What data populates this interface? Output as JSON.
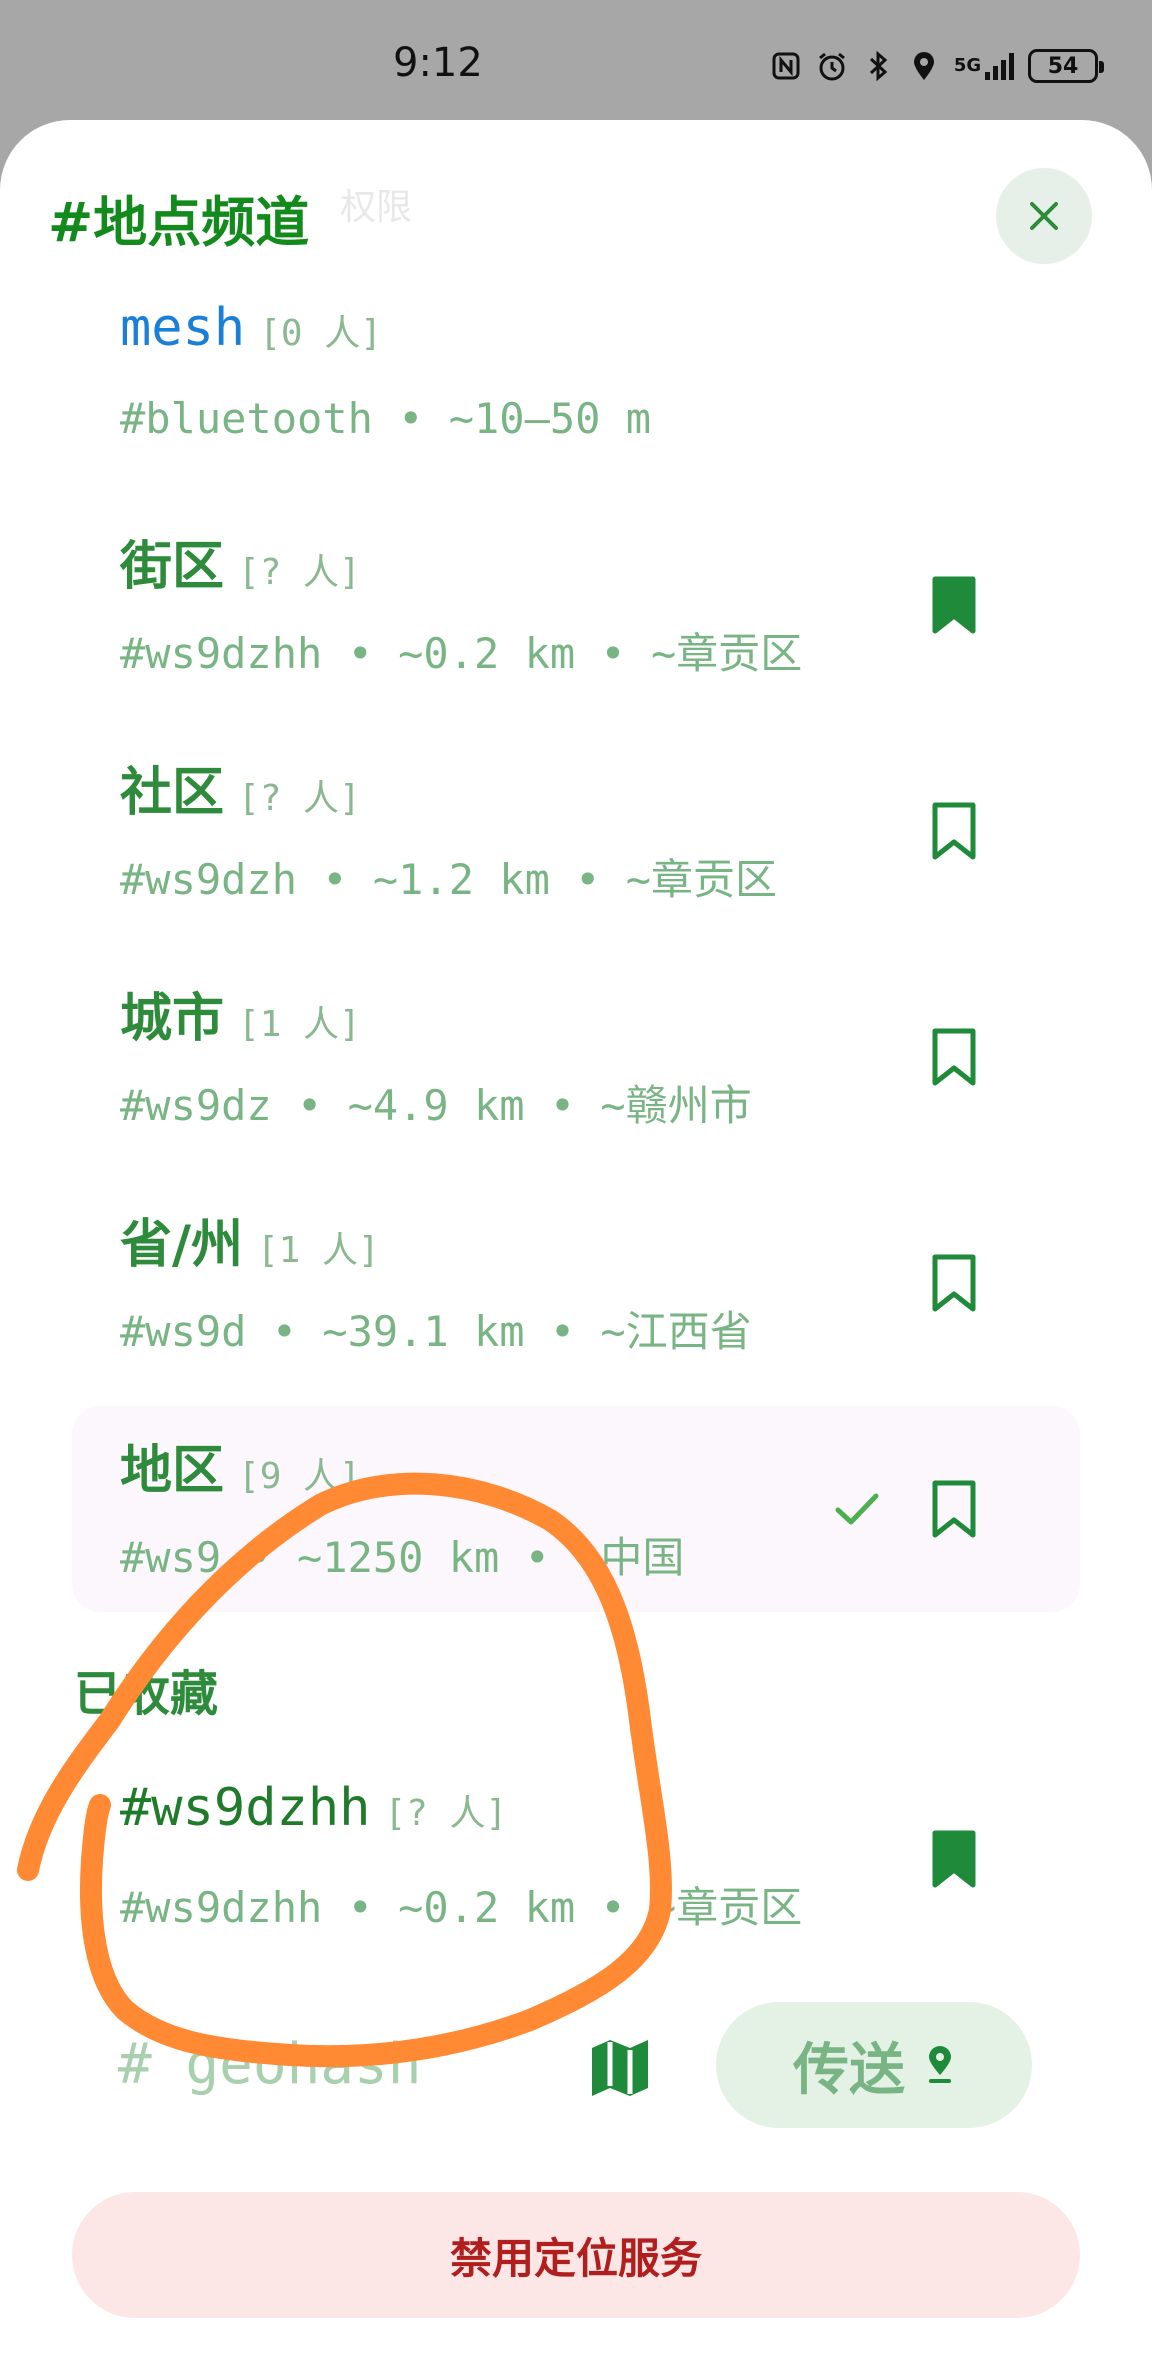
{
  "status_bar": {
    "time": "9:12",
    "network": "5G",
    "battery": "54"
  },
  "sheet": {
    "title": "#地点频道",
    "ghost_title": "权限"
  },
  "channels": [
    {
      "name": "mesh",
      "count": "[0 人]",
      "subtitle": "#bluetooth • ~10–50 m",
      "style": "mesh",
      "bookmark": "none",
      "selected": false
    },
    {
      "name": "街区",
      "count": "[? 人]",
      "subtitle": "#ws9dzhh • ~0.2 km • ~章贡区",
      "style": "normal",
      "bookmark": "filled",
      "selected": false
    },
    {
      "name": "社区",
      "count": "[? 人]",
      "subtitle": "#ws9dzh • ~1.2 km • ~章贡区",
      "style": "normal",
      "bookmark": "outline",
      "selected": false
    },
    {
      "name": "城市",
      "count": "[1 人]",
      "subtitle": "#ws9dz • ~4.9 km • ~赣州市",
      "style": "normal",
      "bookmark": "outline",
      "selected": false
    },
    {
      "name": "省/州",
      "count": "[1 人]",
      "subtitle": "#ws9d • ~39.1 km • ~江西省",
      "style": "normal",
      "bookmark": "outline",
      "selected": false
    },
    {
      "name": "地区",
      "count": "[9 人]",
      "subtitle": "#ws9 • ~1250 km • ~中国",
      "style": "normal",
      "bookmark": "outline",
      "selected": true
    }
  ],
  "bookmarked_section": {
    "label": "已收藏",
    "items": [
      {
        "name": "#ws9dzhh",
        "count": "[? 人]",
        "subtitle": "#ws9dzhh • ~0.2 km • ~章贡区",
        "style": "hash",
        "bookmark": "filled"
      }
    ]
  },
  "geohash_input": {
    "placeholder": "# geohash"
  },
  "send_button": {
    "label": "传送"
  },
  "disable_button": {
    "label": "禁用定位服务"
  },
  "colors": {
    "accent": "#138a1c",
    "bookmark": "#1f8a3a",
    "mesh": "#1a7fd6",
    "danger": "#b01e1e",
    "annotation": "#ff8a33"
  },
  "icons": {
    "close": "close-icon",
    "bookmark": "bookmark-icon",
    "check": "check-icon",
    "map": "map-icon",
    "pin": "location-pin-icon"
  }
}
